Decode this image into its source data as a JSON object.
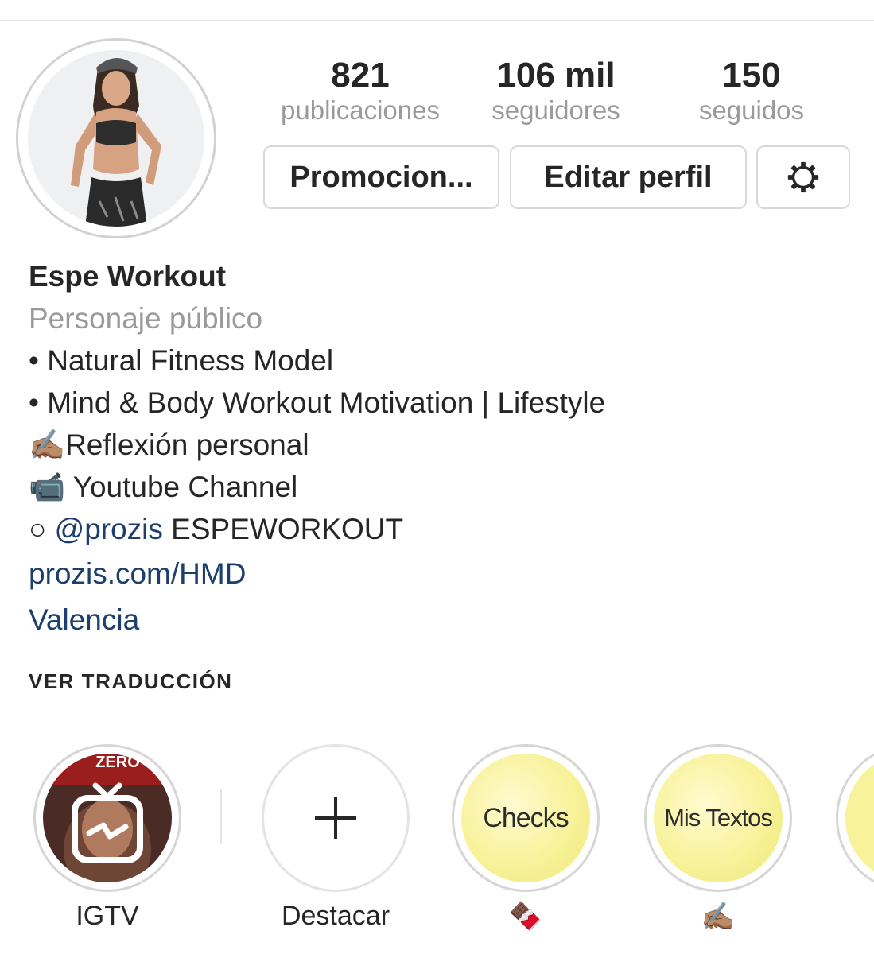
{
  "profile": {
    "avatar_alt": "avatar",
    "stats": [
      {
        "value": "821",
        "label": "publicaciones"
      },
      {
        "value": "106 mil",
        "label": "seguidores"
      },
      {
        "value": "150",
        "label": "seguidos"
      }
    ],
    "buttons": {
      "promote": "Promocion...",
      "edit": "Editar perfil",
      "settings_icon": "gear-icon"
    }
  },
  "bio": {
    "name": "Espe Workout",
    "category": "Personaje público",
    "line1": "• Natural Fitness Model",
    "line2": "• Mind & Body Workout Motivation | Lifestyle",
    "line3_emoji": "✍🏽",
    "line3_text": "Reflexión personal",
    "line4_emoji": "📹",
    "line4_text": " Youtube Channel",
    "line5_prefix": "○ ",
    "line5_mention": "@prozis",
    "line5_suffix": " ESPEWORKOUT",
    "website": "prozis.com/HMD",
    "location": "Valencia",
    "translate": "VER TRADUCCIÓN"
  },
  "highlights": [
    {
      "label": "IGTV",
      "badge": "ZERO"
    },
    {
      "label": "Destacar"
    },
    {
      "title": "Checks",
      "label": "🍫"
    },
    {
      "title": "Mis Textos",
      "label": "✍🏽"
    }
  ],
  "colors": {
    "link": "#1c3f6e",
    "muted": "#9a9a9a",
    "highlight_yellow": "#f8f29a"
  }
}
